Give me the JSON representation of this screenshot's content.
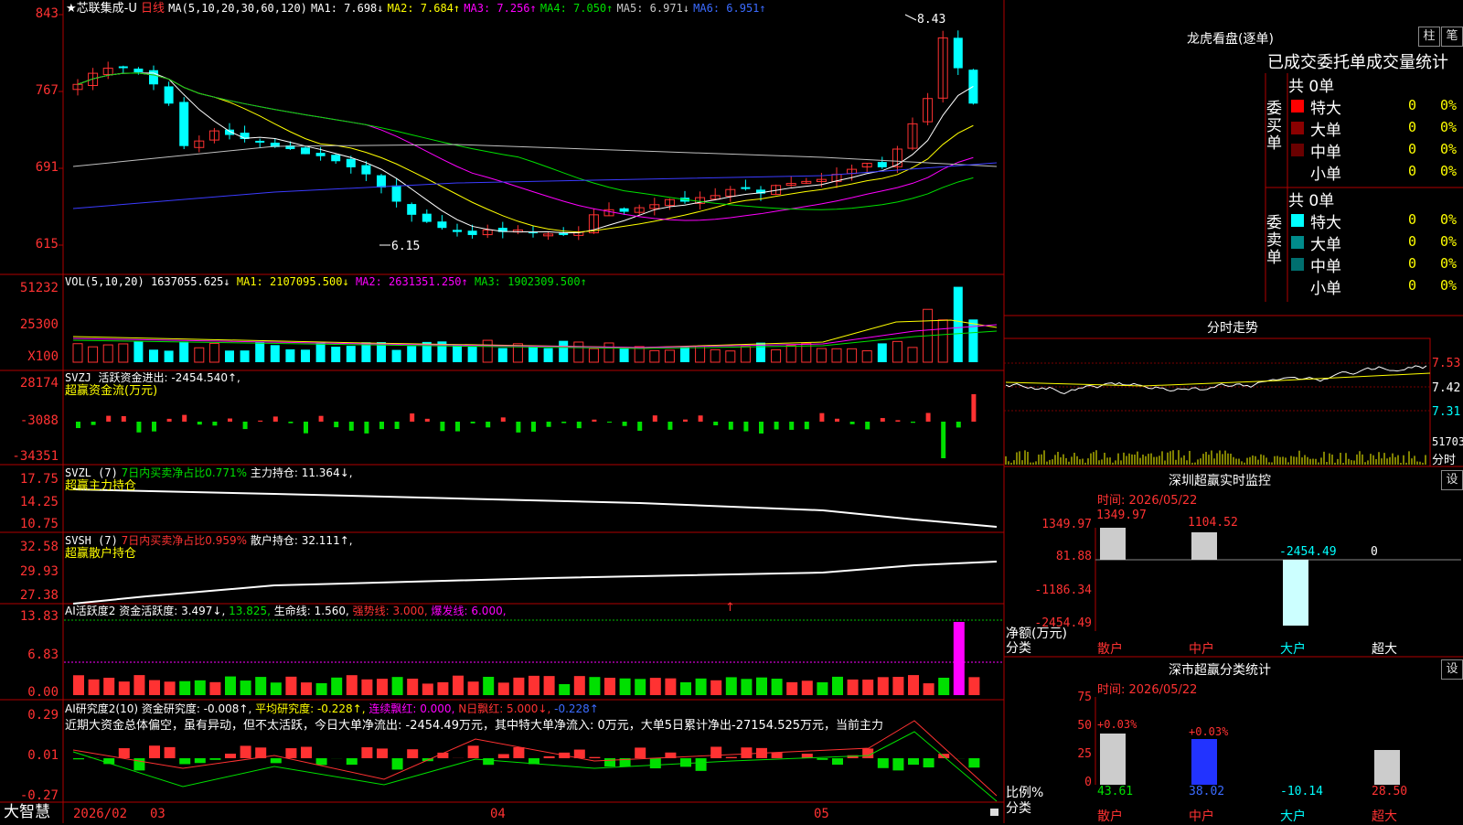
{
  "stock": {
    "name": "芯联集成-U",
    "prefix": "★",
    "period": "日线"
  },
  "ma_legend": {
    "label": "MA(5,10,20,30,60,120)",
    "ma1": "MA1: 7.698↓",
    "ma2": "MA2: 7.684↑",
    "ma3": "MA3: 7.256↑",
    "ma4": "MA4: 7.050↑",
    "ma5": "MA5: 6.971↓",
    "ma6": "MA6: 6.951↑"
  },
  "price_axis": [
    "843",
    "767",
    "691",
    "615"
  ],
  "price_annotations": {
    "high": "8.43",
    "low": "6.15"
  },
  "vol": {
    "label": "VOL(5,10,20)",
    "value": "1637055.625↓",
    "ma1": "MA1: 2107095.500↓",
    "ma2": "MA2: 2631351.250↑",
    "ma3": "MA3: 1902309.500↑",
    "axis": [
      "51232",
      "25300",
      "X100"
    ]
  },
  "svzj": {
    "label": "SVZJ",
    "text": "活跃资金进出: -2454.540↑,",
    "sub": "超赢资金流(万元)",
    "axis": [
      "28174",
      "-3088",
      "-34351"
    ]
  },
  "svzl": {
    "label": "SVZL (7)",
    "ratio": "7日内买卖净占比0.771%",
    "hold": "主力持仓: 11.364↓,",
    "sub": "超赢主力持仓",
    "axis": [
      "17.75",
      "14.25",
      "10.75"
    ]
  },
  "svsh": {
    "label": "SVSH (7)",
    "ratio": "7日内买卖净占比0.959%",
    "hold": "散户持仓: 32.111↑,",
    "sub": "超赢散户持仓",
    "axis": [
      "32.58",
      "29.93",
      "27.38"
    ]
  },
  "ai_active": {
    "label": "AI活跃度2",
    "text": "资金活跃度: 3.497↓,",
    "v2": "13.825,",
    "life": "生命线: 1.560,",
    "strong": "强势线: 3.000,",
    "burst": "爆发线: 6.000,",
    "arrow": "↑",
    "axis": [
      "13.83",
      "6.83",
      "0.00"
    ]
  },
  "ai_research": {
    "label": "AI研究度2(10)",
    "r1": "资金研究度: -0.008↑,",
    "r2": "平均研究度: -0.228↑,",
    "r3": "连续飘红: 0.000,",
    "r4": "N日飘红: 5.000↓,",
    "r5": "-0.228↑",
    "summary": "近期大资金总体偏空，虽有异动，但不太活跃，今日大单净流出: -2454.49万元，其中特大单净流入: 0万元，大单5日累计净出-27154.525万元，当前主力",
    "axis": [
      "0.29",
      "0.01",
      "-0.27"
    ]
  },
  "x_axis": {
    "logo": "大智慧",
    "labels": [
      "2026/02",
      "03",
      "04",
      "05"
    ]
  },
  "dragon": {
    "title": "龙虎看盘(逐单)",
    "btn1": "柱",
    "btn2": "笔",
    "tabs": "已成交委托单成交量统计"
  },
  "buy_orders": {
    "side": "委买单",
    "total": "共 0单",
    "rows": [
      {
        "label": "特大",
        "count": "0",
        "pct": "0%",
        "color": "#ff0000"
      },
      {
        "label": "大单",
        "count": "0",
        "pct": "0%",
        "color": "#8b0000"
      },
      {
        "label": "中单",
        "count": "0",
        "pct": "0%",
        "color": "#6a0000"
      },
      {
        "label": "小单",
        "count": "0",
        "pct": "0%",
        "color": "#000000"
      }
    ]
  },
  "sell_orders": {
    "side": "委卖单",
    "total": "共 0单",
    "rows": [
      {
        "label": "特大",
        "count": "0",
        "pct": "0%",
        "color": "#00ffff"
      },
      {
        "label": "大单",
        "count": "0",
        "pct": "0%",
        "color": "#008b8b"
      },
      {
        "label": "中单",
        "count": "0",
        "pct": "0%",
        "color": "#006f6f"
      },
      {
        "label": "小单",
        "count": "0",
        "pct": "0%",
        "color": "#000000"
      }
    ]
  },
  "intraday": {
    "title": "分时走势",
    "axis": [
      "7.53",
      "7.42",
      "7.31"
    ],
    "vol_label": "51703",
    "vol_unit": "分时"
  },
  "sz_monitor": {
    "title": "深圳超赢实时监控",
    "btn": "设",
    "time": "时间: 2026/05/22",
    "axis": [
      "1349.97",
      "81.88",
      "-1186.34",
      "-2454.49"
    ],
    "bar_values": [
      "1349.97",
      "1104.52",
      "-2454.49",
      "0"
    ],
    "ylabel": "净额(万元)",
    "xlabel": "分类",
    "cats": [
      "散户",
      "中户",
      "大户",
      "超大"
    ]
  },
  "sz_class": {
    "title": "深市超赢分类统计",
    "btn": "设",
    "time": "时间: 2026/05/22",
    "axis": [
      "75",
      "50",
      "25",
      "0"
    ],
    "top_values": [
      "+0.03%",
      "+0.03%"
    ],
    "bottom_values": [
      "43.61",
      "38.02",
      "-10.14",
      "28.50"
    ],
    "ylabel": "比例%",
    "xlabel": "分类",
    "cats": [
      "散户",
      "中户",
      "大户",
      "超大"
    ]
  },
  "colors": {
    "up": "#ff3232",
    "down": "#00ffff",
    "grid": "#b00000",
    "ma1": "#ffffff",
    "ma2": "#ffff00",
    "ma3": "#ff00ff",
    "ma4": "#00e000",
    "ma5": "#c0c0c0",
    "ma6": "#3b3bff"
  }
}
